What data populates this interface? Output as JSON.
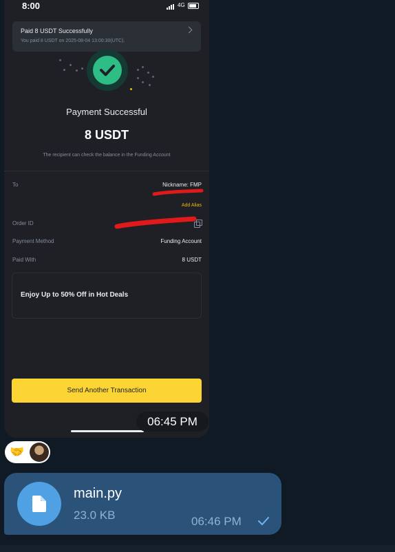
{
  "phone": {
    "status_time": "8:00",
    "network": "4G",
    "notification": {
      "title": "Paid 8 USDT Successfully",
      "subtitle": "You paid 8 USDT on 2025-08-04 13:00:30(UTC)."
    },
    "result": {
      "title": "Payment Successful",
      "amount": "8 USDT",
      "note": "The recipient can check the balance in the Funding Account"
    },
    "details": {
      "to_label": "To",
      "to_value": "Nickname: FMP",
      "add_alias": "Add Alias",
      "order_label": "Order ID",
      "order_value": "",
      "method_label": "Payment Method",
      "method_value": "Funding Account",
      "paidwith_label": "Paid With",
      "paidwith_value": "8 USDT"
    },
    "promo": "Enjoy Up to 50% Off in Hot Deals",
    "send_button": "Send Another Transaction",
    "colors": {
      "accent": "#fcd535",
      "success": "#2ebd85",
      "link": "#f0b90b"
    }
  },
  "message1": {
    "time": "06:45 PM"
  },
  "reactions": {
    "emoji": "🤝"
  },
  "message2": {
    "file_name": "main.py",
    "file_size": "23.0 KB",
    "time": "06:46 PM",
    "icon": "file-icon",
    "status_icon": "check-icon"
  }
}
